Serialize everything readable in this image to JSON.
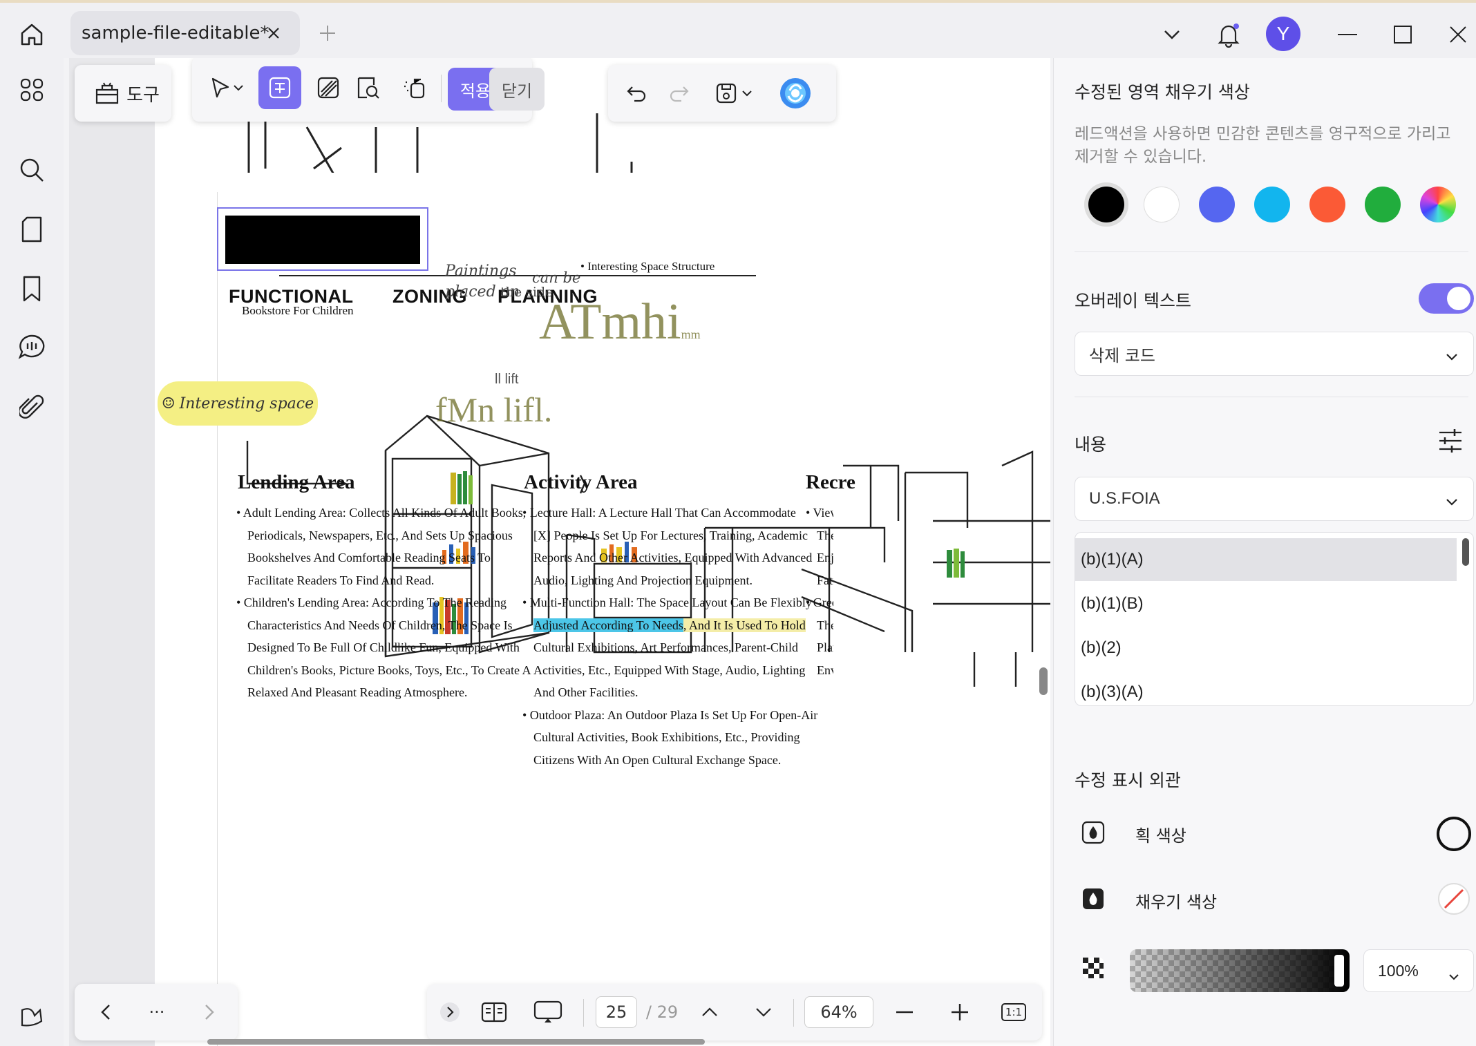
{
  "tab": {
    "title": "sample-file-editable*"
  },
  "toolbar": {
    "tools_label": "도구",
    "apply_label": "적용",
    "close_label": "닫기"
  },
  "document": {
    "headings": [
      "FUNCTIONAL",
      "ZONING",
      "PLANNING"
    ],
    "annotations": {
      "bookstore": "Bookstore For Children",
      "interesting_structure": "• Interesting Space Structure",
      "paintings_line1": "Paintings",
      "paintings_line1b": "can be",
      "paintings_line2": "placed on",
      "paintings_line2b": "the side",
      "lift": "ll lift",
      "yellow_note": "Interesting space",
      "watermark1": "ATmhi",
      "watermark1_small": "mm",
      "watermark2": "fMn lifl."
    },
    "sections": [
      {
        "title": "Lending Area",
        "lines": [
          "• Adult Lending Area: Collects All Kinds Of Adult Books,",
          "Periodicals, Newspapers, Etc., And Sets Up Spacious",
          "Bookshelves And Comfortable Reading Seats To",
          "Facilitate Readers To Find And Read.",
          "• Children's Lending Area: According To The Reading",
          "Characteristics And Needs Of Children, The Space Is",
          "Designed To Be Full Of Childlike Fun, Equipped With",
          "Children's Books, Picture Books, Toys, Etc., To Create A",
          "Relaxed And Pleasant Reading Atmosphere."
        ]
      },
      {
        "title": "Activity Area",
        "lines": [
          "• Lecture Hall: A Lecture Hall That Can Accommodate",
          "[X] People Is Set Up For Lectures, Training, Academic",
          "Reports And Other Activities, Equipped With Advanced",
          "Audio, Lighting And Projection Equipment.",
          "• Multi-Function Hall: The Space Layout Can Be Flexibly",
          "Adjusted According To Needs, And It Is Used To Hold",
          "Cultural Exhibitions, Art Performances, Parent-Child",
          "Activities, Etc., Equipped With Stage, Audio, Lighting",
          "And Other Facilities.",
          "• Outdoor Plaza: An Outdoor Plaza Is Set Up For Open-Air",
          "Cultural Activities, Book Exhibitions, Etc., Providing",
          "Citizens With An Open Cultural Exchange Space."
        ],
        "hl_blue": "Adjusted According To Needs",
        "hl_rest": ", And It Is Used To Hold"
      },
      {
        "title": "Recre",
        "lines": [
          "• Viewi",
          "The U",
          "Enjoy",
          "Fatigu",
          "• Green",
          "The Li",
          "Plante",
          "Envirc"
        ]
      }
    ]
  },
  "bottom": {
    "page_current": "25",
    "page_total": "/ 29",
    "zoom": "64%",
    "fit_label": "1:1",
    "more": "···"
  },
  "panel": {
    "fill_title": "수정된 영역 채우기 색상",
    "fill_desc": "레드액션을 사용하면 민감한 콘텐츠를 영구적으로 가리고 제거할 수 있습니다.",
    "colors": [
      "#000000",
      "#ffffff",
      "#5566f0",
      "#12b5ee",
      "#fb5a36",
      "#21ad3d"
    ],
    "overlay_title": "오버레이 텍스트",
    "overlay_on": true,
    "overlay_select": "삭제 코드",
    "content_title": "내용",
    "content_select": "U.S.FOIA",
    "codes": [
      "(b)(1)(A)",
      "(b)(1)(B)",
      "(b)(2)",
      "(b)(3)(A)"
    ],
    "appearance_title": "수정 표시 외관",
    "stroke_label": "획 색상",
    "fill_label": "채우기 색상",
    "opacity_value": "100%"
  }
}
